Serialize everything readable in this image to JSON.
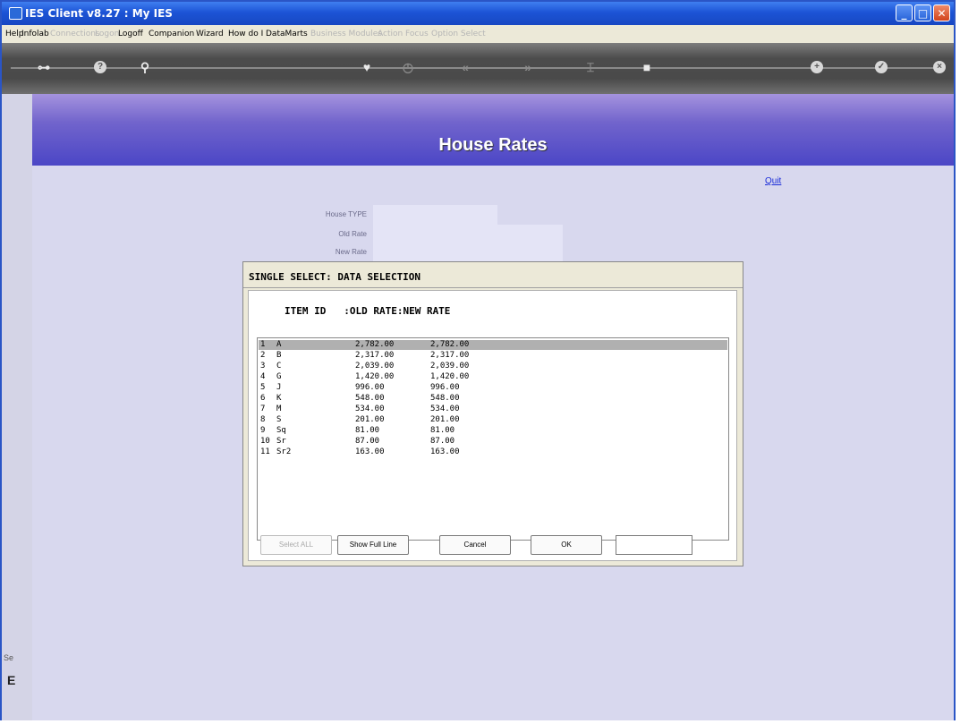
{
  "window": {
    "title": "IES Client v8.27 : My IES",
    "controls": {
      "minimize": "_",
      "maximize": "□",
      "close": "✕"
    }
  },
  "menu": [
    {
      "label": "Help",
      "enabled": true
    },
    {
      "label": "Infolab",
      "enabled": true
    },
    {
      "label": "Connections",
      "enabled": false
    },
    {
      "label": "Logon",
      "enabled": false
    },
    {
      "label": "Logoff",
      "enabled": true
    },
    {
      "label": "Companion",
      "enabled": true
    },
    {
      "label": "Wizard",
      "enabled": true
    },
    {
      "label": "How do I",
      "enabled": true
    },
    {
      "label": "DataMarts",
      "enabled": true
    },
    {
      "label": "Business Modules",
      "enabled": false
    },
    {
      "label": "Action Focus",
      "enabled": false
    },
    {
      "label": "Option Select",
      "enabled": false
    }
  ],
  "toolbar_icons": [
    "key-icon",
    "help-icon",
    "search-icon",
    "heart-icon",
    "clock-icon",
    "rewind-icon",
    "forward-icon",
    "cursor-icon",
    "stop-icon",
    "add-icon",
    "ok-icon",
    "close-icon"
  ],
  "page": {
    "title": "House Rates",
    "quit_label": "Quit"
  },
  "form": {
    "house_type_label": "House TYPE",
    "house_type_value": "",
    "old_rate_label": "Old Rate",
    "old_rate_value": "",
    "new_rate_label": "New Rate",
    "new_rate_value": ""
  },
  "side_fragments": {
    "top": "Se",
    "bottom": "E"
  },
  "dialog": {
    "title": "SINGLE SELECT: DATA SELECTION",
    "column_header": "ITEM ID   :OLD RATE:NEW RATE",
    "rows": [
      {
        "n": "1",
        "id": "A",
        "old": "2,782.00",
        "new": "2,782.00",
        "selected": true
      },
      {
        "n": "2",
        "id": "B",
        "old": "2,317.00",
        "new": "2,317.00"
      },
      {
        "n": "3",
        "id": "C",
        "old": "2,039.00",
        "new": "2,039.00"
      },
      {
        "n": "4",
        "id": "G",
        "old": "1,420.00",
        "new": "1,420.00"
      },
      {
        "n": "5",
        "id": "J",
        "old": "996.00",
        "new": "996.00"
      },
      {
        "n": "6",
        "id": "K",
        "old": "548.00",
        "new": "548.00"
      },
      {
        "n": "7",
        "id": "M",
        "old": "534.00",
        "new": "534.00"
      },
      {
        "n": "8",
        "id": "S",
        "old": "201.00",
        "new": "201.00"
      },
      {
        "n": "9",
        "id": "Sq",
        "old": "81.00",
        "new": "81.00"
      },
      {
        "n": "10",
        "id": "Sr",
        "old": "87.00",
        "new": "87.00"
      },
      {
        "n": "11",
        "id": "Sr2",
        "old": "163.00",
        "new": "163.00"
      }
    ],
    "buttons": {
      "select_all": "Select ALL",
      "show_full_line": "Show Full Line",
      "cancel": "Cancel",
      "ok": "OK"
    },
    "search_value": ""
  }
}
